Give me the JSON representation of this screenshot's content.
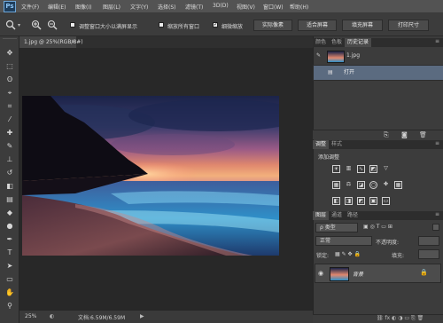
{
  "app": {
    "logo": "Ps"
  },
  "menu": [
    "文件(F)",
    "编辑(E)",
    "图像(I)",
    "图层(L)",
    "文字(Y)",
    "选择(S)",
    "滤镜(T)",
    "3D(D)",
    "视图(V)",
    "窗口(W)",
    "帮助(H)"
  ],
  "options_bar": {
    "checkbox_resize_windows": "调整窗口大小以满屏显示",
    "checkbox_zoom_all": "缩放所有窗口",
    "checkbox_scrubby_zoom": "细微缩放",
    "btn_actual_pixels": "实际像素",
    "btn_fit_screen": "适合屏幕",
    "btn_fill_screen": "填充屏幕",
    "btn_print_size": "打印尺寸"
  },
  "document": {
    "tab_title": "1.jpg @ 25%(RGB/8#)",
    "close_glyph": "×"
  },
  "status": {
    "zoom": "25%",
    "doc_size": "文档:6.59M/6.59M"
  },
  "history_panel": {
    "tabs": [
      "颜色",
      "色板",
      "历史记录"
    ],
    "active_tab": "历史记录",
    "snapshot_name": "1.jpg",
    "step": "打开"
  },
  "adjustments_panel": {
    "tabs": [
      "调整",
      "样式"
    ],
    "active_tab": "调整",
    "title": "添加调整"
  },
  "layers_panel": {
    "tabs": [
      "图层",
      "通道",
      "路径"
    ],
    "active_tab": "图层",
    "filter_kind": "ρ 类型",
    "blend_mode": "正常",
    "opacity_label": "不透明度:",
    "lock_label": "锁定:",
    "fill_label": "填充:",
    "layer_name": "背景"
  },
  "colors": {
    "menubar": "#535353",
    "panel": "#3c3c3c",
    "canvas_bg": "#282828",
    "ps_blue": "#8cc4f4"
  }
}
